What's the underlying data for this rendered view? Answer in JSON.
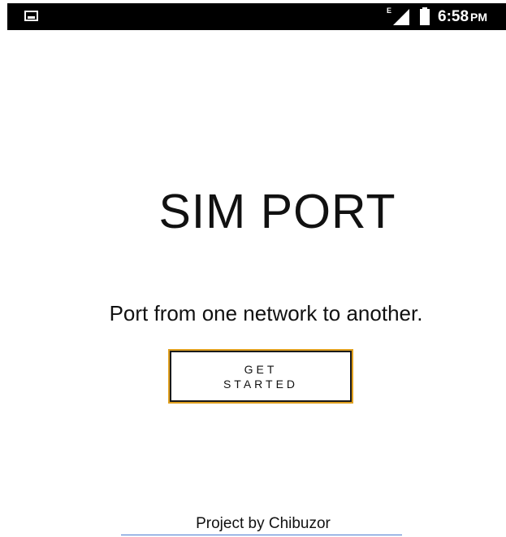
{
  "status_bar": {
    "notification_icon": "image-icon",
    "network_type": "E",
    "signal_icon": "signal-icon",
    "battery_icon": "battery-icon",
    "time": "6:58",
    "ampm": "PM"
  },
  "main": {
    "title": "SIM PORT",
    "tagline": "Port from one network to another.",
    "get_started_label": "GET STARTED"
  },
  "footer": {
    "credit": "Project by Chibuzor"
  },
  "colors": {
    "background": "#ffffff",
    "status_bar": "#000000",
    "button_accent": "#e0a020",
    "underline": "#4a7bd0"
  }
}
